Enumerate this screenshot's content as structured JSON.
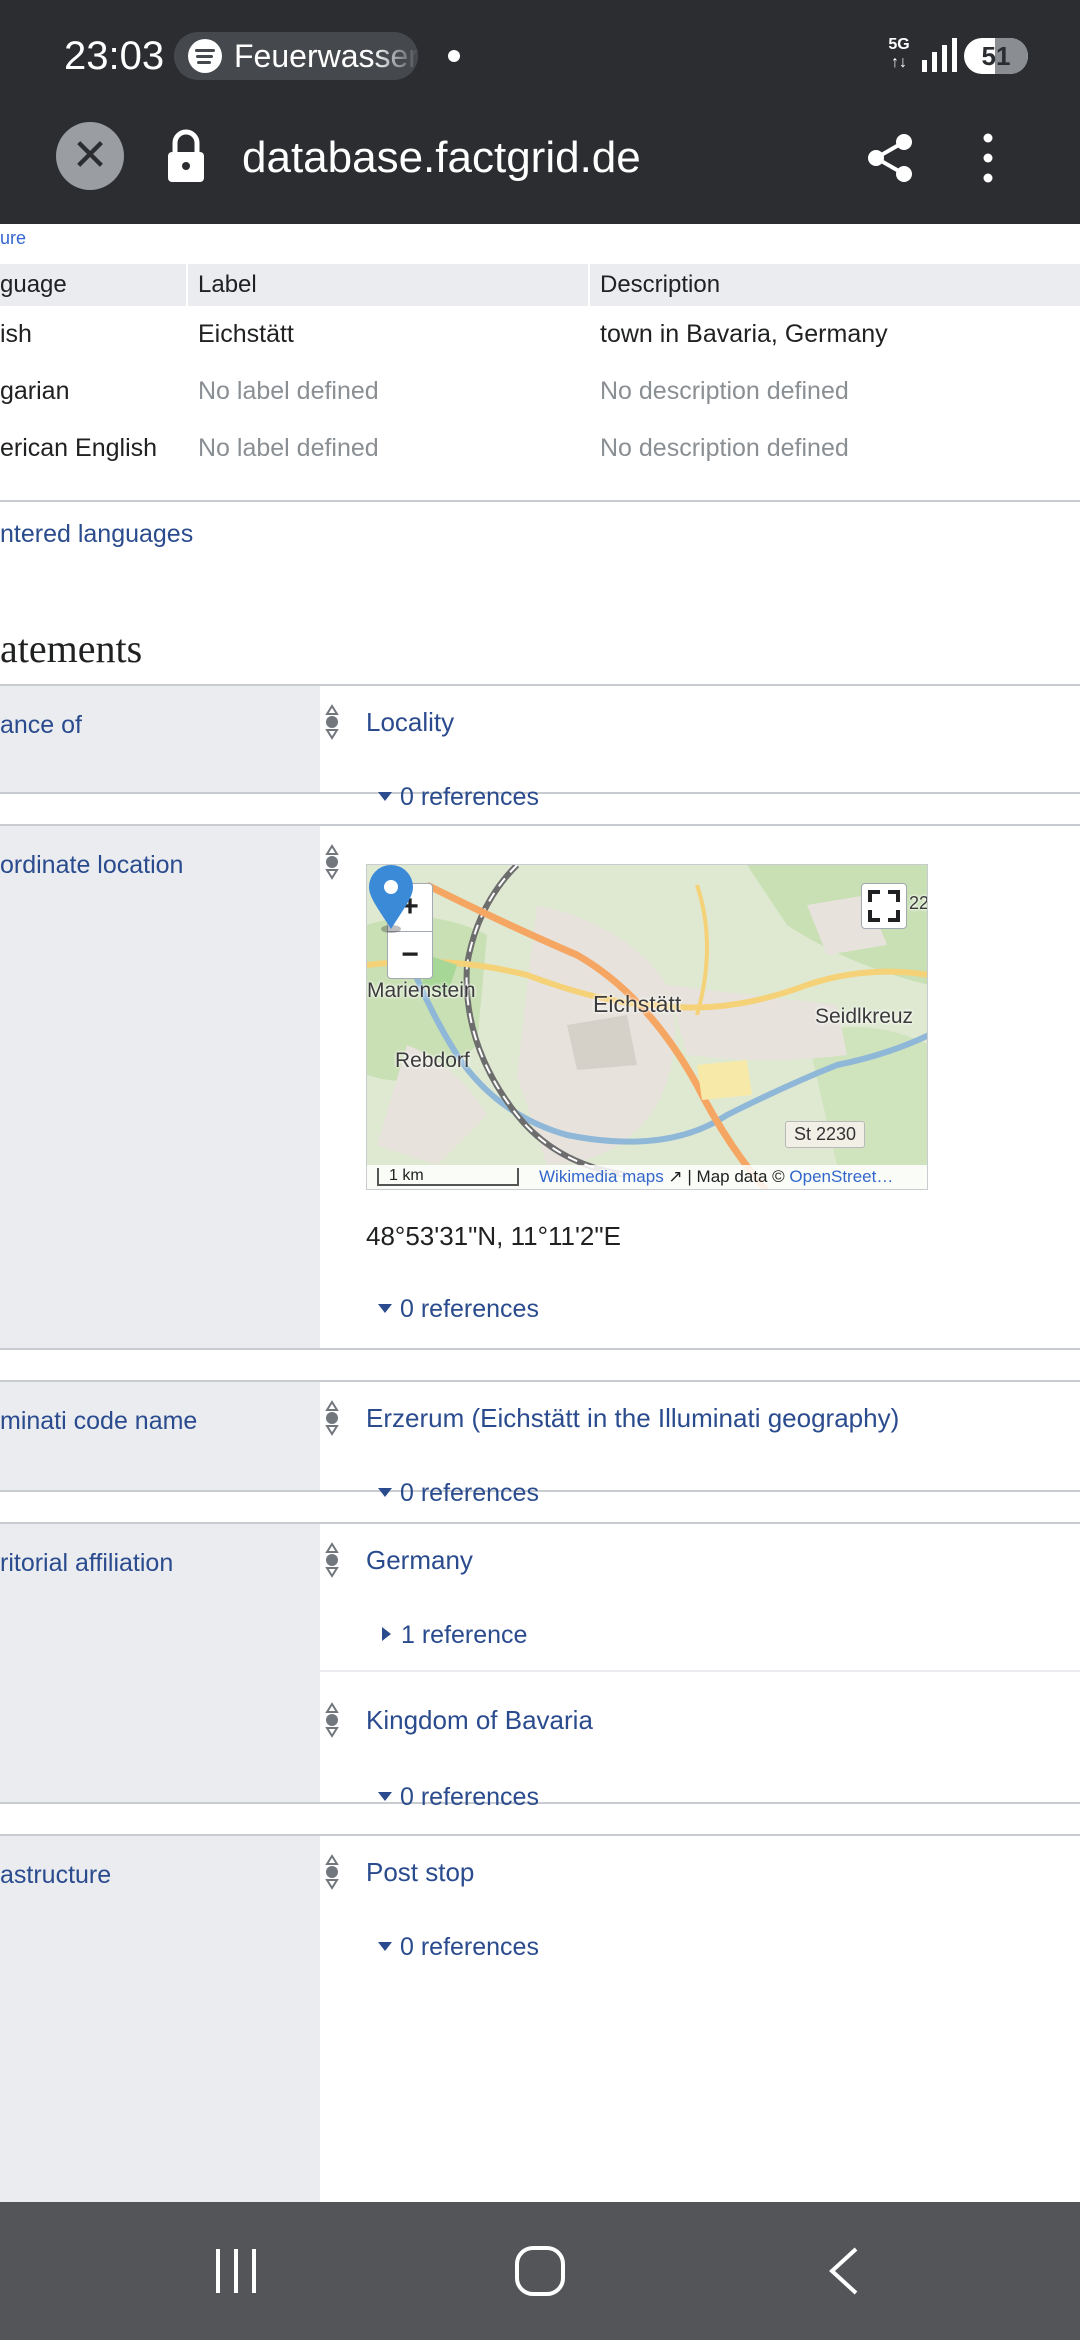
{
  "status_bar": {
    "time": "23:03",
    "notification_app": "Feuerwasser",
    "network": "5G",
    "battery": "51"
  },
  "browser": {
    "url": "database.factgrid.de",
    "close_label": "✕"
  },
  "page": {
    "crumb": "ure",
    "labels_table": {
      "headers": [
        "guage",
        "Label",
        "Description"
      ],
      "rows": [
        {
          "language": "ish",
          "label": "Eichstätt",
          "description": "town in Bavaria, Germany",
          "muted": false
        },
        {
          "language": "garian",
          "label": "No label defined",
          "description": "No description defined",
          "muted": true
        },
        {
          "language": "erican English",
          "label": "No label defined",
          "description": "No description defined",
          "muted": true
        }
      ]
    },
    "all_languages_link": "ntered languages",
    "statements_heading": "atements",
    "statements": {
      "instance_of": {
        "property": "ance of",
        "value": "Locality",
        "references": "0 references"
      },
      "coordinate_location": {
        "property": "ordinate location",
        "map": {
          "places": {
            "a": "Marienstein",
            "b": "Eichstätt",
            "c": "Seidlkreuz",
            "d": "Rebdorf"
          },
          "road": "St 2230",
          "corner_label": "22",
          "scale": "1 km",
          "attribution_link": "Wikimedia maps",
          "attribution_text": " | Map data © ",
          "attribution_osm": "OpenStreet…",
          "zoom_in": "+",
          "zoom_out": "−"
        },
        "coordinates": "48°53'31\"N, 11°11'2\"E",
        "references": "0 references"
      },
      "illuminati_code_name": {
        "property": "minati code name",
        "value": "Erzerum (Eichstätt in the Illuminati geography)",
        "references": "0 references"
      },
      "territorial_affiliation": {
        "property": "ritorial affiliation",
        "values": [
          {
            "value": "Germany",
            "references": "1 reference"
          },
          {
            "value": "Kingdom of Bavaria",
            "references": "0 references"
          }
        ]
      },
      "infrastructure": {
        "property": "astructure",
        "value": "Post stop",
        "references": "0 references"
      }
    }
  },
  "colors": {
    "link": "#2a4b8d",
    "header_bg": "#eaecf0",
    "chrome": "#2b2d30",
    "navbar": "#535559"
  }
}
